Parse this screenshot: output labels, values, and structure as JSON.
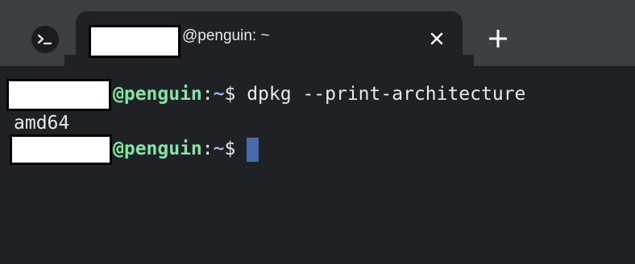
{
  "tab": {
    "title": "@penguin: ~",
    "close_icon": "close-icon",
    "app_icon": "terminal-prompt-icon"
  },
  "new_tab_icon": "plus-icon",
  "terminal": {
    "line1": {
      "host": "@penguin",
      "colon": ":",
      "path": "~",
      "dollar": "$",
      "command": " dpkg --print-architecture"
    },
    "line2": {
      "output": "amd64"
    },
    "line3": {
      "host": "@penguin",
      "colon": ":",
      "path": "~",
      "dollar": "$"
    }
  },
  "colors": {
    "tabstrip": "#3c4043",
    "background": "#202124",
    "host": "#85e3a7",
    "path": "#9ab3ea",
    "cursor": "#4a6aa5"
  }
}
